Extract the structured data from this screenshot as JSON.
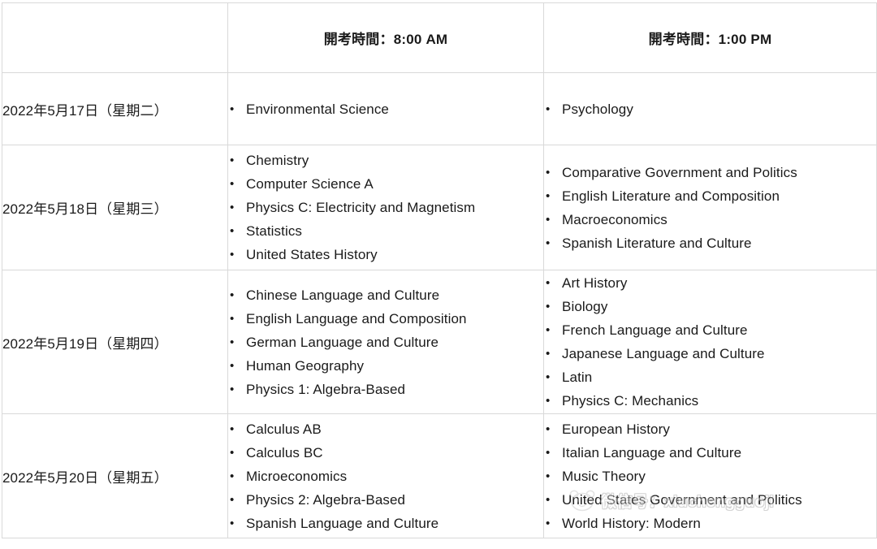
{
  "table": {
    "columns": [
      {
        "key": "date",
        "label": ""
      },
      {
        "key": "morning",
        "label": "開考時間：8:00 AM"
      },
      {
        "key": "afternoon",
        "label": "開考時間：1:00 PM"
      }
    ],
    "rows": [
      {
        "date": "2022年5月17日（星期二）",
        "morning": [
          "Environmental Science"
        ],
        "afternoon": [
          "Psychology"
        ]
      },
      {
        "date": "2022年5月18日（星期三）",
        "morning": [
          "Chemistry",
          "Computer Science A",
          "Physics C: Electricity and Magnetism",
          "Statistics",
          "United States History"
        ],
        "afternoon": [
          "Comparative Government and Politics",
          "English Literature and Composition",
          "Macroeconomics",
          "Spanish Literature and Culture"
        ]
      },
      {
        "date": "2022年5月19日（星期四）",
        "morning": [
          "Chinese Language and Culture",
          "English Language and Composition",
          "German Language and Culture",
          "Human Geography",
          "Physics 1: Algebra-Based"
        ],
        "afternoon": [
          "Art History",
          "Biology",
          "French Language and Culture",
          "Japanese Language and Culture",
          "Latin",
          "Physics C: Mechanics"
        ]
      },
      {
        "date": "2022年5月20日（星期五）",
        "morning": [
          "Calculus AB",
          "Calculus BC",
          "Microeconomics",
          "Physics 2: Algebra-Based",
          "Spanish Language and Culture"
        ],
        "afternoon": [
          "European History",
          "Italian Language and Culture",
          "Music Theory",
          "United States Government and Politics",
          "World History: Modern"
        ]
      }
    ]
  },
  "watermark": {
    "text": "微信号：xiuchengguoji",
    "icon": "panda-face-icon"
  },
  "colors": {
    "border": "#d9d9d9",
    "text": "#1a1a1a",
    "background": "#ffffff"
  }
}
